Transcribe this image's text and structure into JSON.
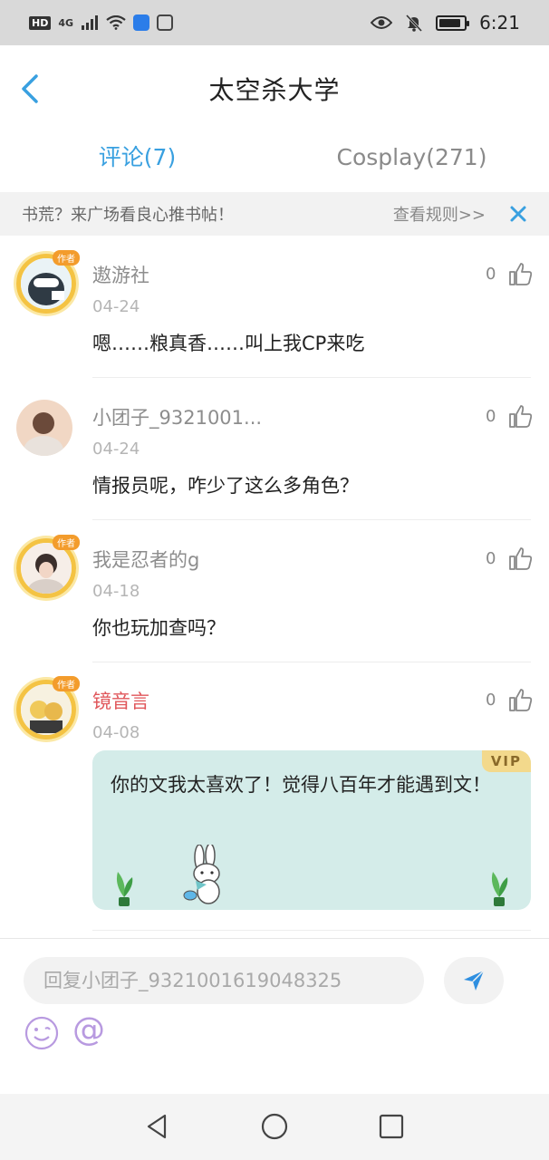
{
  "status_bar": {
    "hd": "HD",
    "network": "4G",
    "time": "6:21"
  },
  "header": {
    "title": "太空杀大学"
  },
  "tabs": [
    {
      "label": "评论(7)",
      "active": true
    },
    {
      "label": "Cosplay(271)",
      "active": false
    }
  ],
  "notice": {
    "text": "书荒？来广场看良心推书帖！",
    "rule_link": "查看规则>>"
  },
  "comments": [
    {
      "username": "遨游社",
      "date": "04-24",
      "content": "嗯……粮真香……叫上我CP来吃",
      "likes": "0",
      "author_badge": "作者"
    },
    {
      "username": "小团子_9321001...",
      "date": "04-24",
      "content": "情报员呢，咋少了这么多角色？",
      "likes": "0"
    },
    {
      "username": "我是忍者的g",
      "date": "04-18",
      "content": "你也玩加查吗？",
      "likes": "0",
      "author_badge": "作者"
    },
    {
      "username": "镜音言",
      "date": "04-08",
      "content": "你的文我太喜欢了！觉得八百年才能遇到文！",
      "likes": "0",
      "vip": "VIP",
      "author_badge": "作者"
    }
  ],
  "input": {
    "placeholder": "回复小团子_9321001619048325"
  },
  "colors": {
    "accent": "#39a0e0",
    "vip_name": "#e0575b",
    "vip_card": "#d4ece9"
  }
}
